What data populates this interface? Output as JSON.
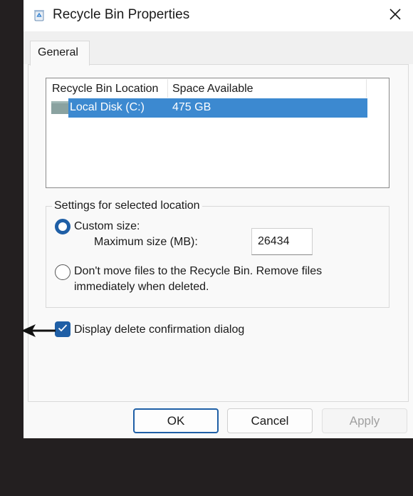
{
  "window": {
    "title": "Recycle Bin Properties",
    "close_symbol": "✕",
    "app_icon": "recycle-bin-icon"
  },
  "tabs": [
    {
      "label": "General",
      "selected": true
    }
  ],
  "location_list": {
    "columns": [
      "Recycle Bin Location",
      "Space Available"
    ],
    "rows": [
      {
        "location": "Local Disk (C:)",
        "space": "475 GB",
        "selected": true,
        "icon": "drive-icon"
      }
    ]
  },
  "settings": {
    "legend": "Settings for selected location",
    "custom_size_label": "Custom size:",
    "custom_size_selected": true,
    "max_size_label": "Maximum size (MB):",
    "max_size_value": "26434",
    "no_recycle_label_line1": "Don't move files to the Recycle Bin. Remove files",
    "no_recycle_label_line2": "immediately when deleted.",
    "no_recycle_selected": false
  },
  "confirm_dialog": {
    "label": "Display delete confirmation dialog",
    "checked": true
  },
  "buttons": {
    "ok": "OK",
    "cancel": "Cancel",
    "apply": "Apply",
    "apply_disabled": true
  },
  "colors": {
    "accent": "#1f5fa6",
    "selection": "#3c89d0",
    "background": "#231f20"
  }
}
